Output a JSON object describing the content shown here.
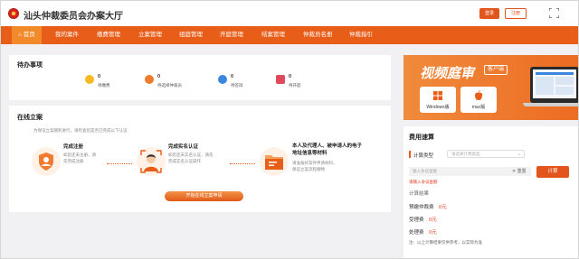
{
  "header": {
    "site_title": "汕头仲裁委员会办案大厅",
    "login_label": "登录",
    "register_label": "注册"
  },
  "nav": {
    "items": [
      "首页",
      "我的案件",
      "缴费管理",
      "立案管理",
      "组庭管理",
      "开庭管理",
      "结案管理",
      "仲裁员名册",
      "仲裁指引"
    ]
  },
  "todo": {
    "title": "待办事项",
    "items": [
      {
        "count": "0",
        "label": "待缴费"
      },
      {
        "count": "0",
        "label": "待选择仲裁员"
      },
      {
        "count": "0",
        "label": "待答辩"
      },
      {
        "count": "0",
        "label": "待开庭"
      }
    ]
  },
  "online": {
    "title": "在线立案",
    "hint": "为保证立案顺利进行，请检查您是否已完成以下认证",
    "steps": [
      {
        "title": "完成注册",
        "desc": "如您还未注册，请先完成注册"
      },
      {
        "title": "完成实名认证",
        "desc": "如您还未实名认证，请先完成实名认证操作"
      },
      {
        "title": "本人及代理人、被申请人的电子地址信息等材料",
        "desc": "请准备好案件申请材料，保证立案流程顺畅"
      }
    ],
    "apply_label": "开始在线立案申请"
  },
  "banner": {
    "title": "视频庭审",
    "tag": "客户端",
    "windows_label": "Windows版",
    "mac_label": "mac版"
  },
  "fee": {
    "title": "费用速算",
    "type_label": "计算类型",
    "type_placeholder": "请选择计费类型",
    "amount_placeholder": "输入争议金额",
    "reset_label": "重置",
    "calc_label": "计算",
    "error_text": "请输入争议金额",
    "result_title": "计算结果",
    "rows": [
      {
        "label": "预缴仲裁费",
        "value": "0元"
      },
      {
        "label": "受理费",
        "value": "0元"
      },
      {
        "label": "处理费",
        "value": "0元"
      }
    ],
    "note": "注：以上计算结果仅供参考，以实际为准"
  },
  "colors": {
    "brand": "#e85d18",
    "accent": "#e2551d",
    "error": "#e2371d"
  }
}
